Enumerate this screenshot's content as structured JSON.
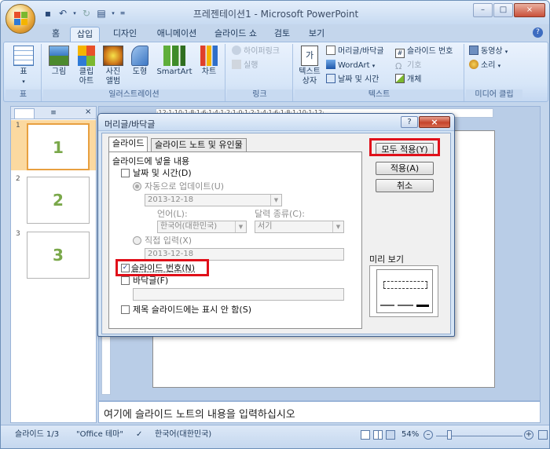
{
  "window": {
    "title": "프레젠테이션1 - Microsoft PowerPoint",
    "controls": [
      "–",
      "□",
      "×"
    ]
  },
  "quick_access": [
    "save-icon",
    "undo-icon",
    "redo-icon",
    "print-preview-icon",
    "customize-icon"
  ],
  "tabs": [
    {
      "label": "홈"
    },
    {
      "label": "삽입"
    },
    {
      "label": "디자인"
    },
    {
      "label": "애니메이션"
    },
    {
      "label": "슬라이드 쇼"
    },
    {
      "label": "검토"
    },
    {
      "label": "보기"
    }
  ],
  "active_tab": "삽입",
  "ribbon": {
    "groups": {
      "table": {
        "label": "표",
        "buttons": [
          "표"
        ]
      },
      "illustrations": {
        "label": "일러스트레이션",
        "buttons": [
          "그림",
          "클립 아트",
          "사진 앨범",
          "도형",
          "SmartArt",
          "차트"
        ]
      },
      "links": {
        "label": "링크",
        "buttons": [
          "하이퍼링크",
          "실행"
        ]
      },
      "text": {
        "label": "텍스트",
        "buttons": [
          "텍스트 상자",
          "머리글/바닥글",
          "WordArt",
          "날짜 및 시간",
          "슬라이드 번호",
          "기호",
          "개체"
        ]
      },
      "media": {
        "label": "미디어 클립",
        "buttons": [
          "동영상",
          "소리"
        ]
      }
    }
  },
  "slides": [
    {
      "number": "1",
      "label": "1"
    },
    {
      "number": "2",
      "label": "2"
    },
    {
      "number": "3",
      "label": "3"
    }
  ],
  "ruler": {
    "marks": "·12·1·10·1·8·1·6·1·4·1·2·1·0·1·2·1·4·1·6·1·8·1·10·1·12·"
  },
  "notes": {
    "placeholder": "여기에 슬라이드 노트의 내용을 입력하십시오"
  },
  "status": {
    "slide": "슬라이드 1/3",
    "theme": "\"Office 테마\"",
    "language": "한국어(대한민국)",
    "zoom": "54%"
  },
  "dialog": {
    "title": "머리글/바닥글",
    "help": "?",
    "close": "×",
    "tabs": [
      "슬라이드",
      "슬라이드 노트 및 유인물"
    ],
    "section_title": "슬라이드에 넣을 내용",
    "date_time": {
      "label": "날짜 및 시간(D)",
      "checked": false
    },
    "auto_update": {
      "label": "자동으로 업데이트(U)",
      "value": "2013-12-18"
    },
    "language": {
      "label": "언어(L):",
      "value": "한국어(대한민국)"
    },
    "calendar": {
      "label": "달력 종류(C):",
      "value": "서기"
    },
    "fixed": {
      "label": "직접 입력(X)",
      "value": "2013-12-18"
    },
    "slide_number": {
      "label": "슬라이드 번호(N)",
      "checked": true
    },
    "footer": {
      "label": "바닥글(F)",
      "checked": false,
      "value": ""
    },
    "title_slide": {
      "label": "제목 슬라이드에는 표시 안 함(S)",
      "checked": false
    },
    "buttons": {
      "apply_all": "모두 적용(Y)",
      "apply": "적용(A)",
      "cancel": "취소"
    },
    "preview_label": "미리 보기"
  }
}
